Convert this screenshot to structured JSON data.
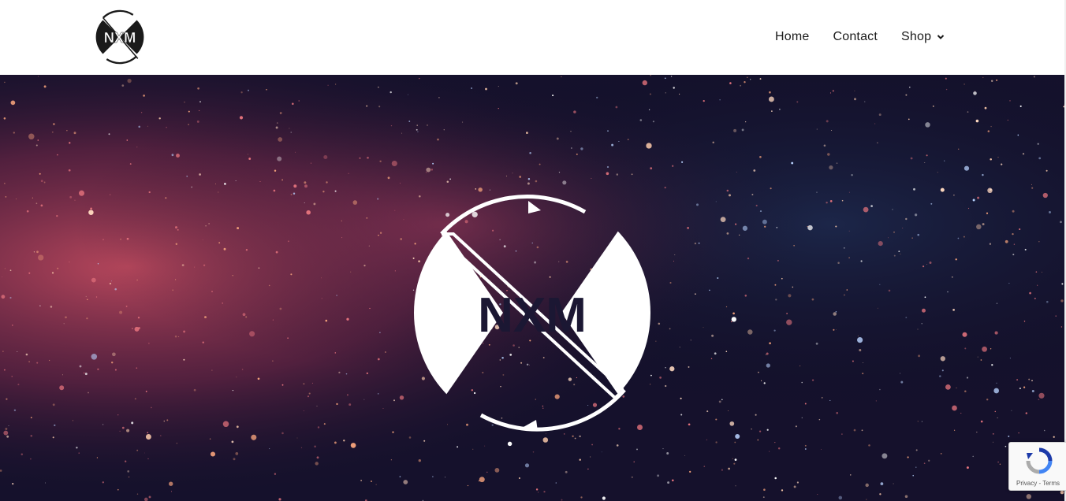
{
  "header": {
    "logo": {
      "text": "NXM",
      "icon": "nxm-logo-icon"
    },
    "nav": {
      "items": [
        {
          "label": "Home"
        },
        {
          "label": "Contact"
        },
        {
          "label": "Shop",
          "icon": "chevron-down-icon"
        }
      ]
    }
  },
  "hero": {
    "logo": {
      "text": "NXM",
      "icon": "nxm-logo-icon"
    },
    "background": "starfield-nebula",
    "colors": {
      "deep": "#15112c",
      "pink": "#e07a7a",
      "blue": "#3a6ea8"
    }
  },
  "recaptcha": {
    "icon": "recaptcha-icon",
    "privacy_label": "Privacy",
    "separator": " - ",
    "terms_label": "Terms"
  }
}
